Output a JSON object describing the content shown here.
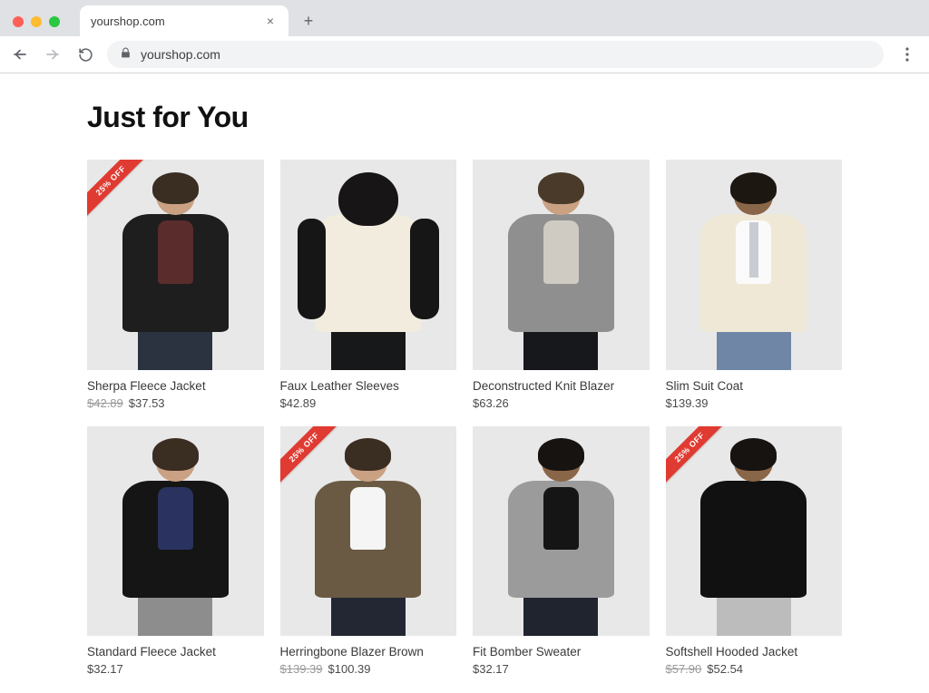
{
  "browser": {
    "tab_title": "yourshop.com",
    "url": "yourshop.com"
  },
  "section_title": "Just for You",
  "sale_badge_text": "25% OFF",
  "products": [
    {
      "name": "Sherpa Fleece Jacket",
      "old_price": "$42.89",
      "price": "$37.53",
      "on_sale": true
    },
    {
      "name": "Faux Leather Sleeves",
      "old_price": "",
      "price": "$42.89",
      "on_sale": false
    },
    {
      "name": "Deconstructed Knit Blazer",
      "old_price": "",
      "price": "$63.26",
      "on_sale": false
    },
    {
      "name": "Slim Suit Coat",
      "old_price": "",
      "price": "$139.39",
      "on_sale": false
    },
    {
      "name": "Standard Fleece Jacket",
      "old_price": "",
      "price": "$32.17",
      "on_sale": false
    },
    {
      "name": "Herringbone Blazer Brown",
      "old_price": "$139.39",
      "price": "$100.39",
      "on_sale": true
    },
    {
      "name": "Fit Bomber Sweater",
      "old_price": "",
      "price": "$32.17",
      "on_sale": false
    },
    {
      "name": "Softshell Hooded Jacket",
      "old_price": "$57.90",
      "price": "$52.54",
      "on_sale": true
    }
  ]
}
